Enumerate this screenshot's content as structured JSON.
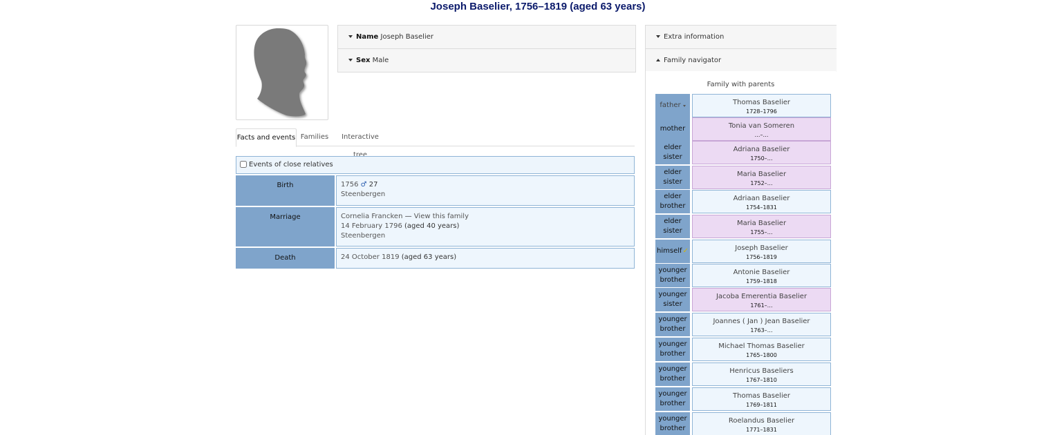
{
  "page": {
    "title": "Joseph Baselier, 1756–1819 (aged 63 years)"
  },
  "summary": {
    "name": {
      "label": "Name",
      "value": "Joseph Baselier"
    },
    "sex": {
      "label": "Sex",
      "value": "Male"
    }
  },
  "tabs": [
    {
      "label": "Facts and events",
      "active": true
    },
    {
      "label": "Families",
      "active": false
    },
    {
      "label": "Interactive tree",
      "active": false
    }
  ],
  "facts": {
    "close_relatives_label": "Events of close relatives",
    "close_relatives_checked": false,
    "birth": {
      "label": "Birth",
      "date": "1756",
      "sex_symbol": "♂",
      "age": "27",
      "place": "Steenbergen"
    },
    "marriage": {
      "label": "Marriage",
      "spouse": "Cornelia Francken",
      "separator": "—",
      "view_family": "View this family",
      "date": "14 February 1796",
      "age": "(aged 40 years)",
      "place": "Steenbergen"
    },
    "death": {
      "label": "Death",
      "date": "24 October 1819",
      "age": "(aged 63 years)"
    }
  },
  "sidebar": {
    "extra_info_label": "Extra information",
    "family_navigator_label": "Family navigator",
    "family_caption": "Family with parents",
    "members": [
      {
        "relation": "father",
        "name": "Thomas Baselier",
        "years": "1728–1796",
        "sex": "male"
      },
      {
        "relation": "mother",
        "name": "Tonia van Someren",
        "years": "…–…",
        "sex": "female"
      },
      {
        "relation": "elder sister",
        "name": "Adriana Baselier",
        "years": "1750–…",
        "sex": "female"
      },
      {
        "relation": "elder sister",
        "name": "Maria Baselier",
        "years": "1752–…",
        "sex": "female"
      },
      {
        "relation": "elder brother",
        "name": "Adriaan Baselier",
        "years": "1754–1831",
        "sex": "male"
      },
      {
        "relation": "elder sister",
        "name": "Maria Baselier",
        "years": "1755–…",
        "sex": "female"
      },
      {
        "relation": "himself",
        "name": "Joseph Baselier",
        "years": "1756–1819",
        "sex": "male"
      },
      {
        "relation": "younger brother",
        "name": "Antonie Baselier",
        "years": "1759–1818",
        "sex": "male"
      },
      {
        "relation": "younger sister",
        "name": "Jacoba Emerentia Baselier",
        "years": "1761–…",
        "sex": "female"
      },
      {
        "relation": "younger brother",
        "name": "Joannes ( Jan ) Jean Baselier",
        "years": "1763–…",
        "sex": "male"
      },
      {
        "relation": "younger brother",
        "name": "Michael Thomas Baselier",
        "years": "1765–1800",
        "sex": "male"
      },
      {
        "relation": "younger brother",
        "name": "Henricus Baseliers",
        "years": "1767–1810",
        "sex": "male"
      },
      {
        "relation": "younger brother",
        "name": "Thomas Baselier",
        "years": "1769–1811",
        "sex": "male"
      },
      {
        "relation": "younger brother",
        "name": "Roelandus Baselier",
        "years": "1771–1831",
        "sex": "male"
      }
    ]
  },
  "colors": {
    "title": "#0b1a6b",
    "label_cell": "#7fa4cb",
    "male_cell": "#eef6fd",
    "female_cell": "#ecdaf3",
    "silhouette": "#7a7a7a"
  },
  "icons": [
    "silhouette-icon",
    "caret-down-icon",
    "caret-up-icon",
    "male-icon",
    "check-icon",
    "checkbox-icon"
  ]
}
